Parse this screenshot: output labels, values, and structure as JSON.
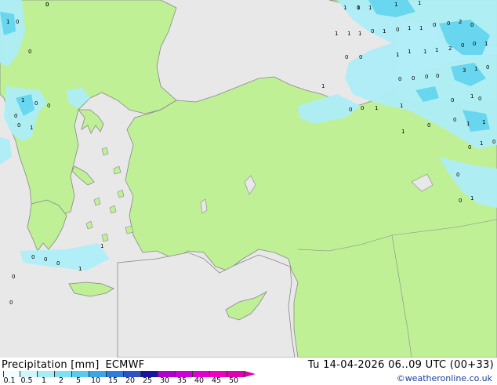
{
  "title": {
    "product": "Precipitation [mm]",
    "model": "ECMWF",
    "valid_time": "Tu 14-04-2026 06..09 UTC (00+33)"
  },
  "credit": "©weatheronline.co.uk",
  "colors": {
    "sea": "#e8e8e8",
    "land": "#bff096",
    "coast": "#888888",
    "precip_light": "#aeeef8",
    "precip_mid": "#60d4ee"
  },
  "legend": {
    "labels": [
      "0.1",
      "0.5",
      "1",
      "2",
      "5",
      "10",
      "15",
      "20",
      "25",
      "30",
      "35",
      "40",
      "45",
      "50"
    ],
    "colors": [
      "#f0fcff",
      "#cdf5fb",
      "#a6ecf7",
      "#7fe0f4",
      "#56cdee",
      "#3aa6e4",
      "#2f7ddb",
      "#2b53c6",
      "#14169e",
      "#b000cf",
      "#cc00d9",
      "#e000cf",
      "#f000c0",
      "#e000b0"
    ]
  },
  "point_labels": [
    "0",
    "1",
    "1",
    "1",
    "1",
    "1",
    "0",
    "1",
    "1",
    "1",
    "1",
    "0",
    "1",
    "0",
    "1",
    "1",
    "0",
    "0",
    "2",
    "0",
    "1",
    "1",
    "1",
    "1",
    "2",
    "0",
    "0",
    "1",
    "3",
    "1",
    "0",
    "0",
    "0",
    "0",
    "1",
    "0",
    "0",
    "0",
    "0",
    "0",
    "0",
    "1",
    "0",
    "0",
    "0",
    "0",
    "1",
    "1",
    "0",
    "1",
    "1",
    "0",
    "1",
    "1",
    "0",
    "1",
    "0",
    "0",
    "0",
    "1",
    "0",
    "0",
    "0",
    "1",
    "0",
    "0",
    "1",
    "0",
    "1",
    "0",
    "0",
    "0"
  ]
}
